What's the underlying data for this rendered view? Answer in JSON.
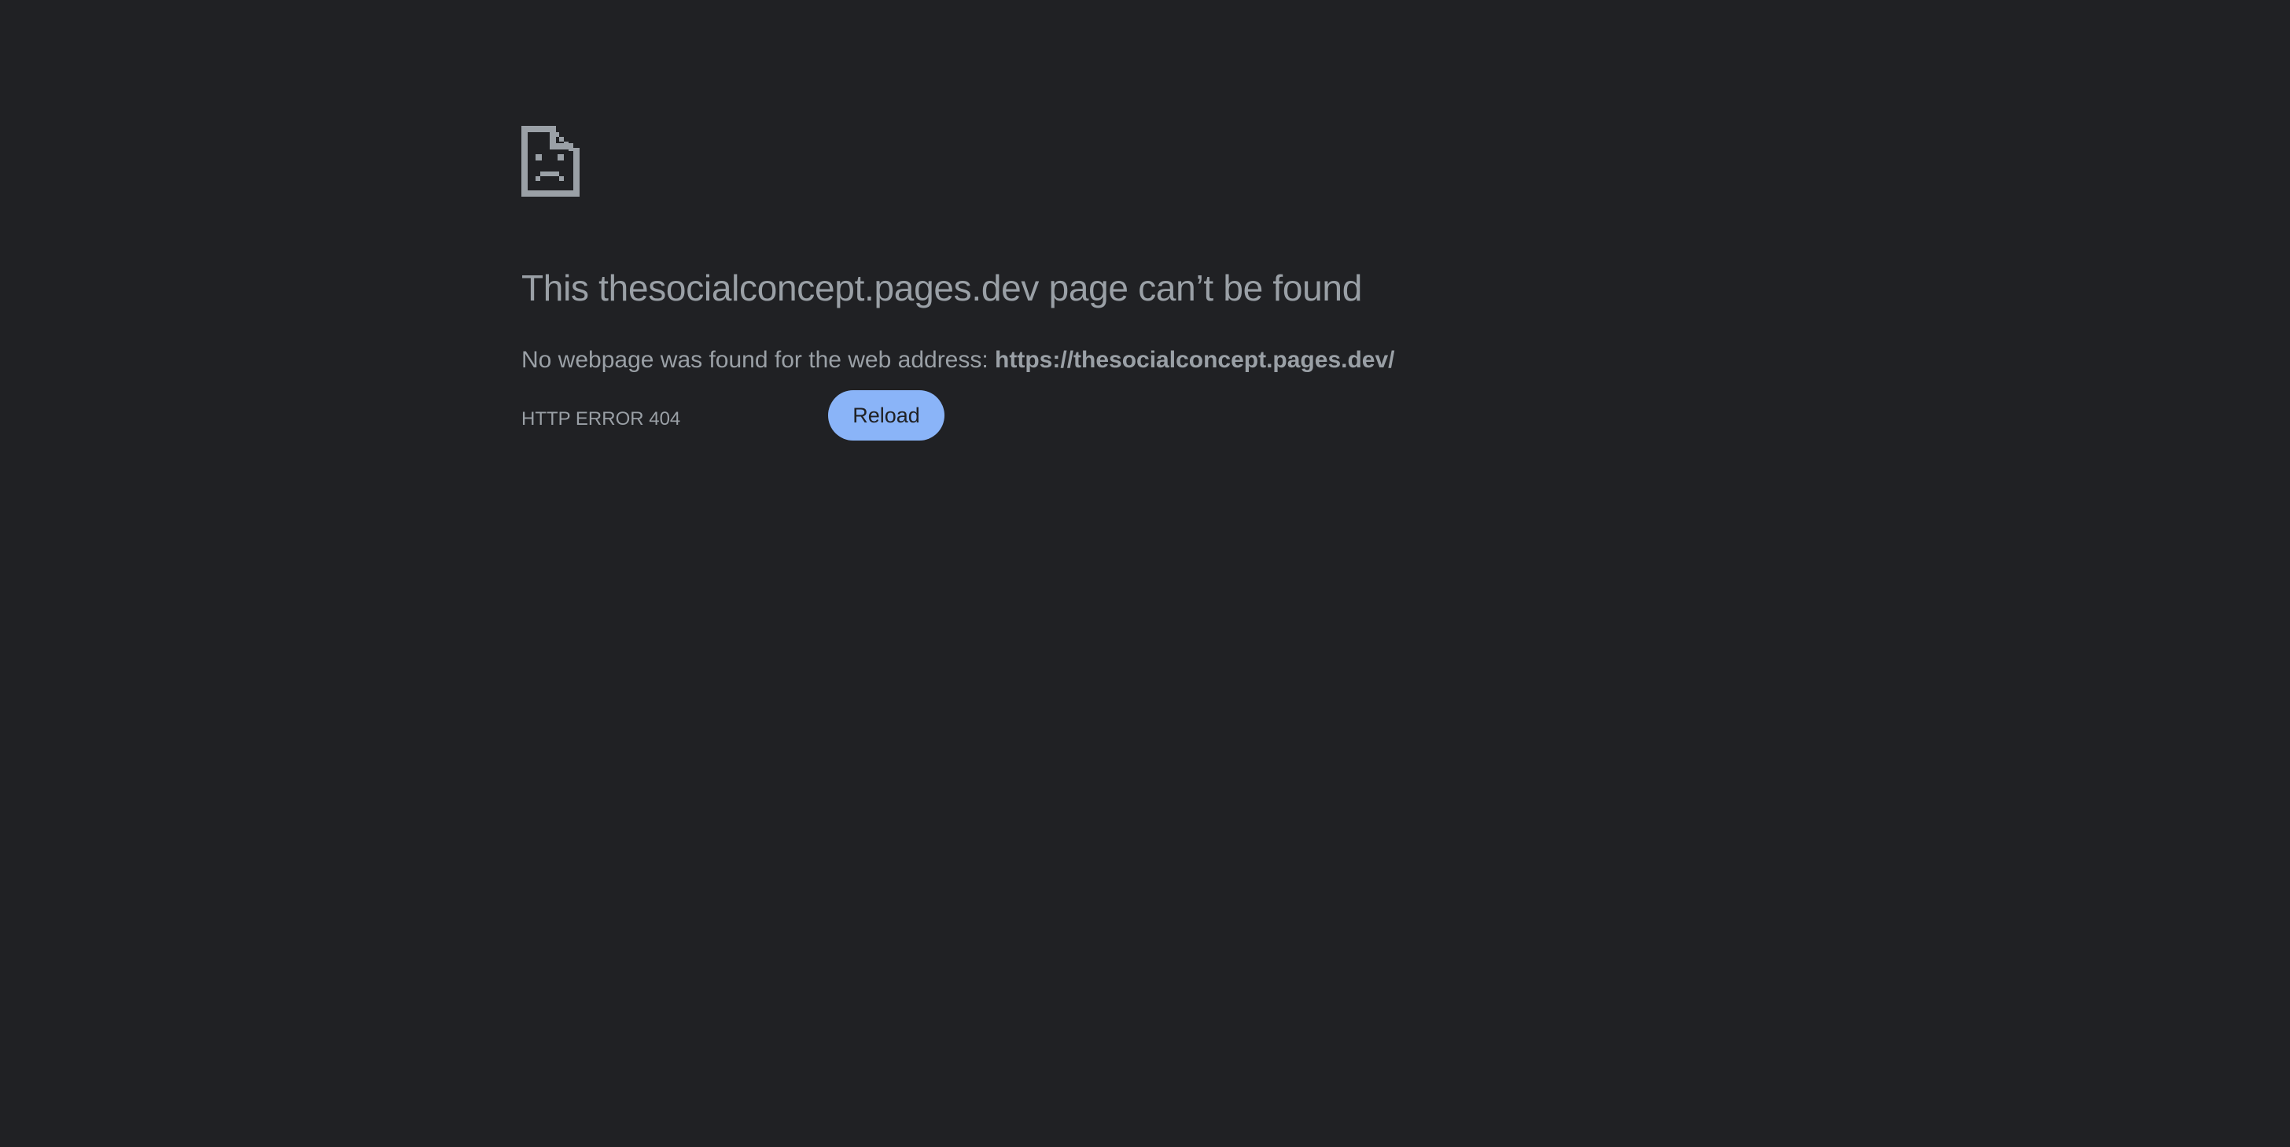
{
  "page": {
    "icon": "sad-document-icon",
    "headline": "This thesocialconcept.pages.dev page can’t be found",
    "message_prefix": "No webpage was found for the web address: ",
    "message_address": "https://thesocialconcept.pages.dev/",
    "error_code": "HTTP ERROR 404",
    "reload_label": "Reload"
  },
  "colors": {
    "background": "#202124",
    "text": "#9aa0a6",
    "button_background": "#8ab4f8",
    "button_text": "#202124"
  }
}
